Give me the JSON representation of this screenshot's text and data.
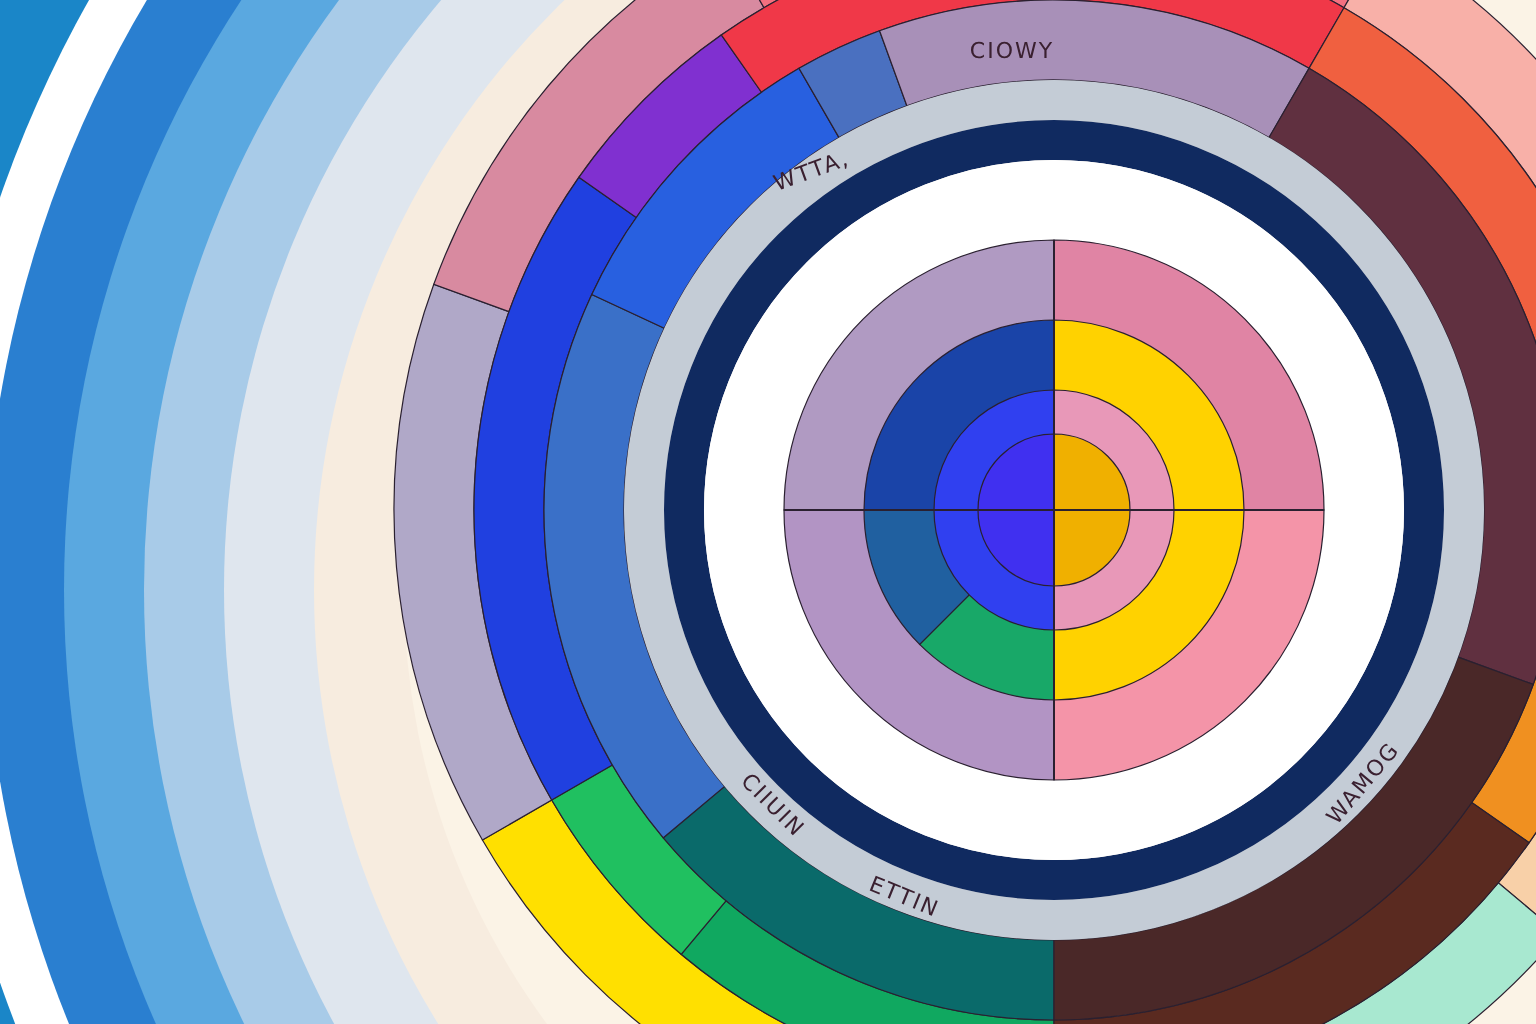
{
  "wheel_labels": [
    {
      "text": "CIOWY"
    },
    {
      "text": "WTTA,"
    },
    {
      "text": "CIIUIN"
    },
    {
      "text": "ETTIN"
    },
    {
      "text": "WAMOG"
    }
  ]
}
